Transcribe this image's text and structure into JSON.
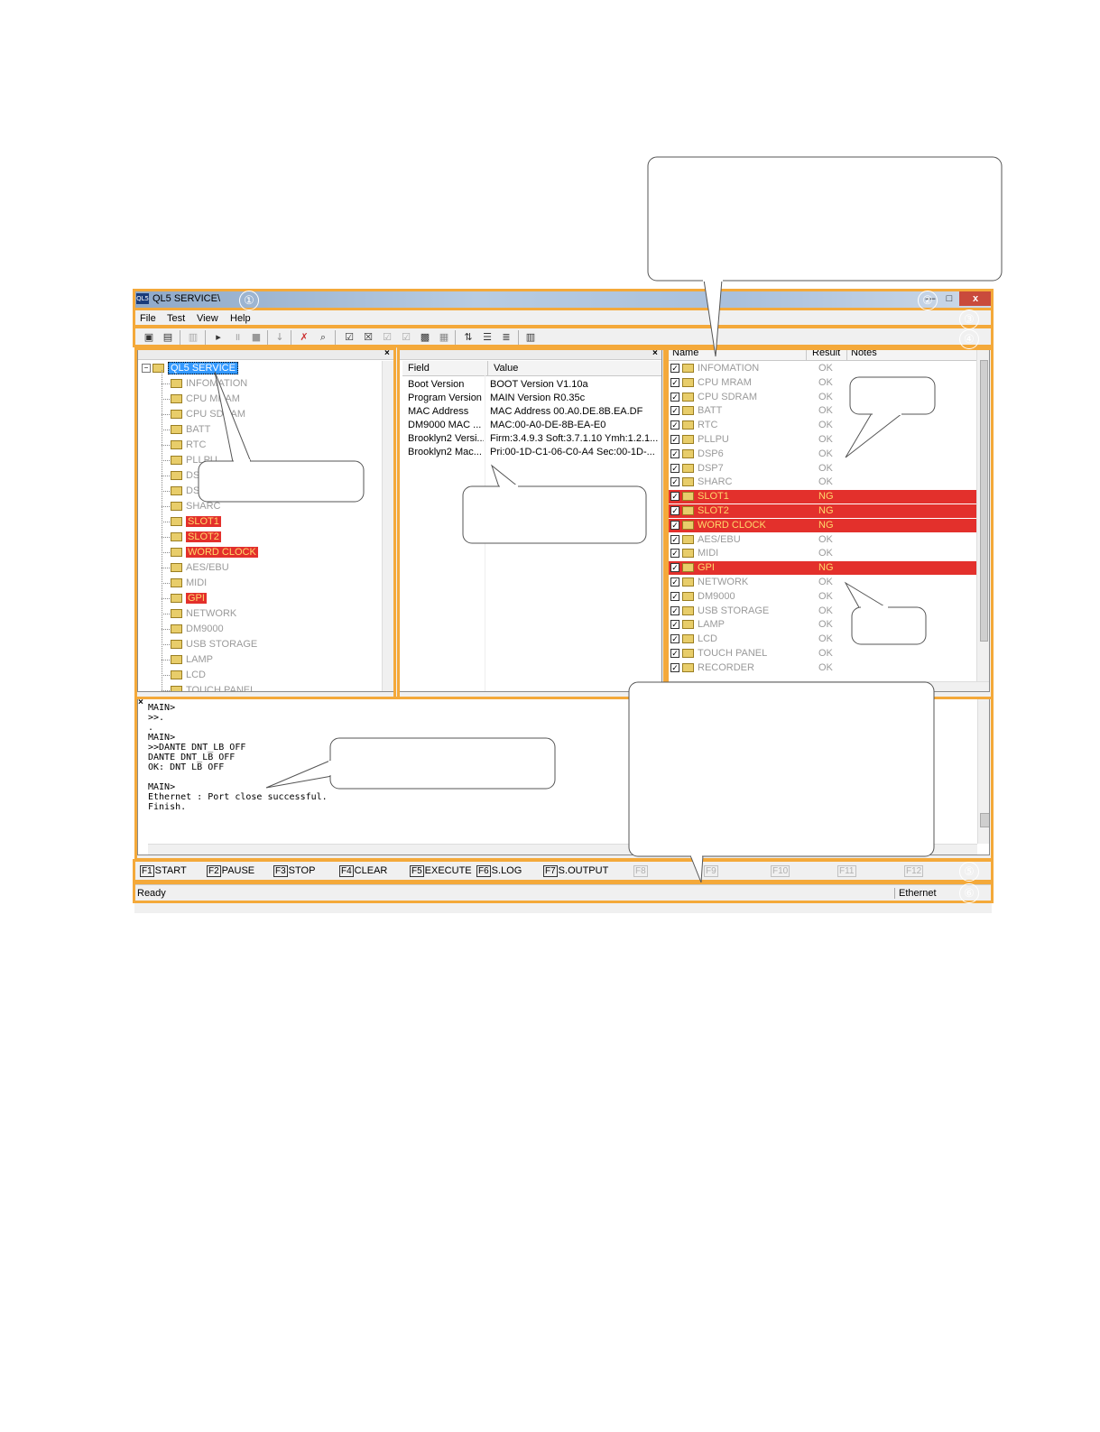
{
  "window": {
    "title": "QL5 SERVICE\\",
    "app_icon": "QL5"
  },
  "window_buttons": {
    "minimize": "—",
    "maximize": "□",
    "close": "x"
  },
  "menu": [
    {
      "label": "File"
    },
    {
      "label": "Test"
    },
    {
      "label": "View"
    },
    {
      "label": "Help"
    }
  ],
  "tree": {
    "root": "QL5 SERVICE",
    "items": [
      {
        "label": "INFOMATION",
        "state": "normal"
      },
      {
        "label": "CPU MRAM",
        "state": "normal"
      },
      {
        "label": "CPU SDRAM",
        "state": "normal"
      },
      {
        "label": "BATT",
        "state": "normal"
      },
      {
        "label": "RTC",
        "state": "normal"
      },
      {
        "label": "PLLPU",
        "state": "normal"
      },
      {
        "label": "DSP6",
        "state": "normal"
      },
      {
        "label": "DSP7",
        "state": "normal"
      },
      {
        "label": "SHARC",
        "state": "normal"
      },
      {
        "label": "SLOT1",
        "state": "ng"
      },
      {
        "label": "SLOT2",
        "state": "ng"
      },
      {
        "label": "WORD CLOCK",
        "state": "ng"
      },
      {
        "label": "AES/EBU",
        "state": "normal"
      },
      {
        "label": "MIDI",
        "state": "normal"
      },
      {
        "label": "GPI",
        "state": "ng"
      },
      {
        "label": "NETWORK",
        "state": "normal"
      },
      {
        "label": "DM9000",
        "state": "normal"
      },
      {
        "label": "USB STORAGE",
        "state": "normal"
      },
      {
        "label": "LAMP",
        "state": "normal"
      },
      {
        "label": "LCD",
        "state": "normal"
      },
      {
        "label": "TOUCH PANEL",
        "state": "normal"
      }
    ]
  },
  "info_table": {
    "columns": [
      "Field",
      "Value"
    ],
    "rows": [
      {
        "field": "Boot Version",
        "value": "BOOT Version V1.10a"
      },
      {
        "field": "Program Version",
        "value": "MAIN Version R0.35c"
      },
      {
        "field": "MAC Address",
        "value": "MAC Address 00.A0.DE.8B.EA.DF"
      },
      {
        "field": "DM9000 MAC ...",
        "value": "MAC:00-A0-DE-8B-EA-E0"
      },
      {
        "field": "Brooklyn2 Versi...",
        "value": "Firm:3.4.9.3 Soft:3.7.1.10 Ymh:1.2.1...."
      },
      {
        "field": "Brooklyn2 Mac...",
        "value": "Pri:00-1D-C1-06-C0-A4  Sec:00-1D-..."
      }
    ]
  },
  "results_table": {
    "columns": [
      "Name",
      "Result",
      "Notes"
    ],
    "rows": [
      {
        "name": "INFOMATION",
        "result": "OK",
        "ng": false
      },
      {
        "name": "CPU MRAM",
        "result": "OK",
        "ng": false
      },
      {
        "name": "CPU SDRAM",
        "result": "OK",
        "ng": false
      },
      {
        "name": "BATT",
        "result": "OK",
        "ng": false
      },
      {
        "name": "RTC",
        "result": "OK",
        "ng": false
      },
      {
        "name": "PLLPU",
        "result": "OK",
        "ng": false
      },
      {
        "name": "DSP6",
        "result": "OK",
        "ng": false
      },
      {
        "name": "DSP7",
        "result": "OK",
        "ng": false
      },
      {
        "name": "SHARC",
        "result": "OK",
        "ng": false
      },
      {
        "name": "SLOT1",
        "result": "NG",
        "ng": true
      },
      {
        "name": "SLOT2",
        "result": "NG",
        "ng": true
      },
      {
        "name": "WORD CLOCK",
        "result": "NG",
        "ng": true
      },
      {
        "name": "AES/EBU",
        "result": "OK",
        "ng": false
      },
      {
        "name": "MIDI",
        "result": "OK",
        "ng": false
      },
      {
        "name": "GPI",
        "result": "NG",
        "ng": true
      },
      {
        "name": "NETWORK",
        "result": "OK",
        "ng": false
      },
      {
        "name": "DM9000",
        "result": "OK",
        "ng": false
      },
      {
        "name": "USB STORAGE",
        "result": "OK",
        "ng": false
      },
      {
        "name": "LAMP",
        "result": "OK",
        "ng": false
      },
      {
        "name": "LCD",
        "result": "OK",
        "ng": false
      },
      {
        "name": "TOUCH PANEL",
        "result": "OK",
        "ng": false
      },
      {
        "name": "RECORDER",
        "result": "OK",
        "ng": false
      }
    ]
  },
  "console_lines": [
    "MAIN>",
    ">>.",
    ".",
    "MAIN>",
    ">>DANTE DNT_LB OFF",
    "DANTE DNT_LB OFF",
    "OK: DNT LB OFF",
    "",
    "MAIN>",
    "Ethernet : Port close successful.",
    "Finish."
  ],
  "function_keys": [
    {
      "key": "F1",
      "label": "START",
      "enabled": true
    },
    {
      "key": "F2",
      "label": "PAUSE",
      "enabled": true
    },
    {
      "key": "F3",
      "label": "STOP",
      "enabled": true
    },
    {
      "key": "F4",
      "label": "CLEAR",
      "enabled": true
    },
    {
      "key": "F5",
      "label": "EXECUTE",
      "enabled": true
    },
    {
      "key": "F6",
      "label": "S.LOG",
      "enabled": true
    },
    {
      "key": "F7",
      "label": "S.OUTPUT",
      "enabled": true
    },
    {
      "key": "F8",
      "label": "",
      "enabled": false
    },
    {
      "key": "F9",
      "label": "",
      "enabled": false
    },
    {
      "key": "F10",
      "label": "",
      "enabled": false
    },
    {
      "key": "F11",
      "label": "",
      "enabled": false
    },
    {
      "key": "F12",
      "label": "",
      "enabled": false
    }
  ],
  "status": {
    "text": "Ready",
    "connection": "Ethernet"
  },
  "markers": [
    "①",
    "②",
    "③",
    "④",
    "⑤",
    "⑥"
  ],
  "colors": {
    "ng_highlight": "#e3302c",
    "ng_text": "#ffd86b",
    "frame_outline": "#f4a93a",
    "selection": "#3399ff"
  }
}
